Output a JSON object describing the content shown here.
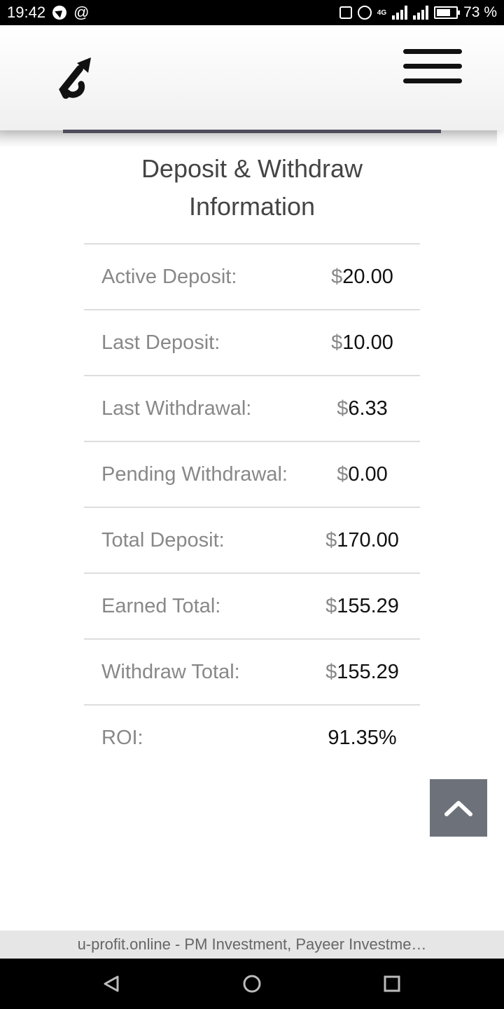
{
  "status_bar": {
    "time": "19:42",
    "at_symbol": "@",
    "network": "4G",
    "battery": "73 %",
    "icons": [
      "location-icon",
      "vibrate-icon",
      "alarm-icon",
      "signal-icon",
      "battery-icon"
    ]
  },
  "header": {
    "logo_icon": "arrow-logo-icon",
    "menu_icon": "hamburger-menu-icon"
  },
  "section": {
    "title_line1": "Deposit & Withdraw",
    "title_line2": "Information"
  },
  "rows": [
    {
      "label": "Active Deposit:",
      "currency": "$",
      "value": "20.00"
    },
    {
      "label": "Last Deposit:",
      "currency": "$",
      "value": "10.00"
    },
    {
      "label": "Last Withdrawal:",
      "currency": "$",
      "value": "6.33"
    },
    {
      "label": "Pending Withdrawal:",
      "currency": "$",
      "value": "0.00"
    },
    {
      "label": "Total Deposit:",
      "currency": "$",
      "value": "170.00"
    },
    {
      "label": "Earned Total:",
      "currency": "$",
      "value": "155.29"
    },
    {
      "label": "Withdraw Total:",
      "currency": "$",
      "value": "155.29"
    },
    {
      "label": "ROI:",
      "currency": "",
      "value": "91.35%"
    }
  ],
  "scroll_top_icon": "chevron-up-icon",
  "url_bar": {
    "text": "u-profit.online - PM Investment, Payeer Investme…"
  },
  "nav_bar": {
    "icons": [
      "back-icon",
      "home-icon",
      "recents-icon"
    ]
  },
  "colors": {
    "header_line": "#4f4c5c",
    "scroll_button": "#6d727a",
    "label_text": "#888888",
    "value_text": "#111111"
  }
}
